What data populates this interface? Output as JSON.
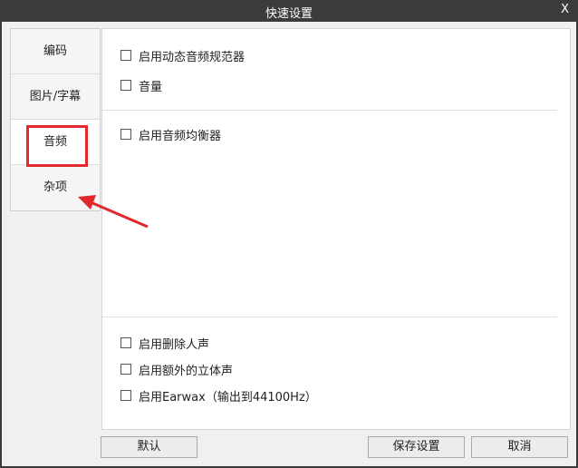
{
  "window": {
    "title": "快速设置",
    "close_label": "X"
  },
  "sidebar": {
    "items": [
      {
        "label": "编码"
      },
      {
        "label": "图片/字幕"
      },
      {
        "label": "音频"
      },
      {
        "label": "杂项"
      }
    ]
  },
  "audio": {
    "options_top": [
      {
        "label": "启用动态音频规范器",
        "checked": false
      },
      {
        "label": "音量",
        "checked": false
      }
    ],
    "equalizer": {
      "label": "启用音频均衡器",
      "checked": false
    },
    "options_bottom": [
      {
        "label": "启用删除人声",
        "checked": false
      },
      {
        "label": "启用额外的立体声",
        "checked": false
      },
      {
        "label": "启用Earwax（输出到44100Hz）",
        "checked": false
      }
    ]
  },
  "buttons": {
    "default": "默认",
    "save": "保存设置",
    "cancel": "取消"
  },
  "annotation": {
    "highlight_color": "#e0282d"
  }
}
